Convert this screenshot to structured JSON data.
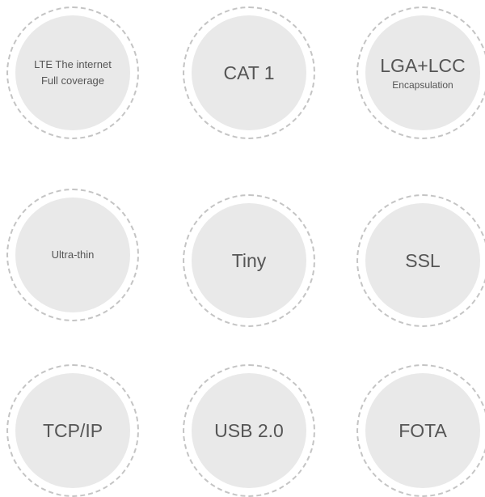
{
  "badges": {
    "lte": {
      "line1": "LTE The internet",
      "line2": "Full coverage"
    },
    "cat1": {
      "label": "CAT 1"
    },
    "lga": {
      "label": "LGA+LCC",
      "sub": "Encapsulation"
    },
    "ultrathin": {
      "label": "Ultra-thin"
    },
    "tiny": {
      "label": "Tiny"
    },
    "ssl": {
      "label": "SSL"
    },
    "tcpip": {
      "label": "TCP/IP"
    },
    "usb": {
      "label": "USB 2.0"
    },
    "fota": {
      "label": "FOTA"
    }
  },
  "colors": {
    "circle_fill": "#e9e9e9",
    "dashed_ring": "#c4c4c4",
    "text": "#555555",
    "background": "#ffffff"
  }
}
